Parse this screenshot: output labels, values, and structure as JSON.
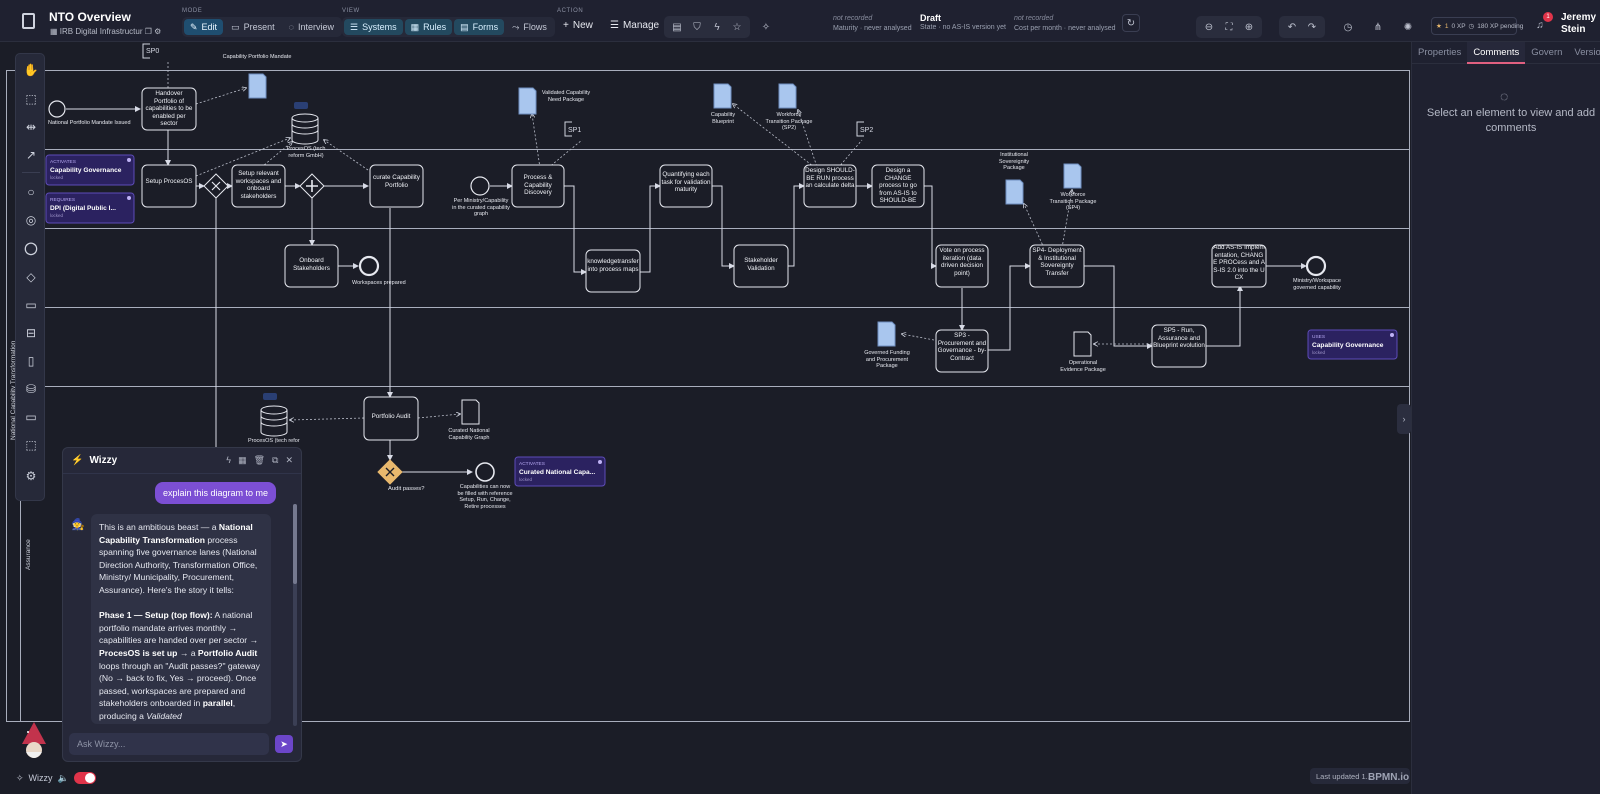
{
  "header": {
    "title": "NTO Overview",
    "subtitle": "IRB Digital Infrastructur",
    "mode_label": "MODE",
    "view_label": "VIEW",
    "action_label": "ACTION",
    "modes": [
      "Edit",
      "Present",
      "Interview"
    ],
    "views": [
      "Systems",
      "Rules",
      "Forms",
      "Flows"
    ],
    "new_label": "New",
    "manage_label": "Manage",
    "status": {
      "maturity_value": "not recorded",
      "maturity_label": "Maturity · never analysed",
      "state_value": "Draft",
      "state_label": "State · no AS-IS version yet",
      "cost_value": "not recorded",
      "cost_label": "Cost per month · never analysed"
    },
    "xp_level": "1",
    "xp_value": "0 XP",
    "xp_pending": "180 XP pending",
    "notification_count": "1",
    "user_name": "Jeremy Stein"
  },
  "sidebar": {
    "tabs": [
      "Properties",
      "Comments",
      "Govern",
      "Versions"
    ],
    "active_tab": "Comments",
    "message": "Select an element to view and add comments"
  },
  "diagram": {
    "pool_name": "National Capability Transformation",
    "lane_last": "Assurance",
    "sp0": "SP0",
    "capability_mandate": "Capability Portfolio Mandate",
    "national_mandate": "National Portfolio Mandate Issued",
    "handover": "Handover Portfolio of capabilities to be enabled per sector",
    "setup_procesos": "Setup ProcesOS",
    "procesos_db": "ProcesOS (tech reform GmbH)",
    "setup_workspaces": "Setup relevant workspaces and onboard stakeholders",
    "curate_portfolio": "curate Capability Portfolio",
    "onboard": "Onboard Stakeholders",
    "workspaces_prepared": "Workspaces prepared",
    "per_ministry": "Per Ministry/Capability in the curated capability graph",
    "validated_pkg": "Validated Capability Need Package",
    "sp1": "SP1",
    "process_discovery": "Process & Capability Discovery",
    "knowledge_transfer": "knowledgetransfer into process maps",
    "quantifying": "Quantifying each task for validation maturity",
    "stakeholder_validation": "Stakeholder Validation",
    "cap_blueprint": "Capability Blueprint",
    "wf_sp2": "Workforce Transition Package (SP2)",
    "sp2": "SP2",
    "design_should": "Design SHOULD-BE RUN process an calculate delta",
    "design_change": "Design a CHANGE process to go from AS-IS to SHOULD-BE",
    "inst_sov_pkg": "Institutional Sovereignity Package",
    "wf_sp4": "Workforce Transition Package (SP4)",
    "vote": "Vote on process iteration (data driven decision point)",
    "sp4": "SP4- Deployment & Institutional Sovereignty Transfer",
    "add_asis": "Add AS-IS Implementation, CHANGE PROCess and AS-IS 2.0 into the UCX",
    "ministry_governed": "Ministry/Workspace governed capability",
    "governed_funding": "Governed Funding and Procurement Package",
    "sp3": "SP3 - Procurement and Governance - by- Contract",
    "operational_evidence": "Operational Evidence Package",
    "sp5": "SP5 - Run, Assurance and Blueprint evolution",
    "portfolio_audit": "Portfolio Audit",
    "curated_graph": "Curated National Capability Graph",
    "audit_passes": "Audit passes?",
    "capabilities_filled": "Capabilities can now be filled with reference Setup, Run, Change, Retire processes",
    "procesos_db2": "ProcesOS (tech reform GmbH)",
    "cards": {
      "activates_label": "ACTIVATES",
      "requires_label": "REQUIRES",
      "uses_label": "USES",
      "locked": "locked",
      "cap_gov": "Capability Governance",
      "dpi": "DPI (Digital Public I...",
      "cap_gov2": "Capability Governance",
      "curated_nat": "Curated National Capa..."
    }
  },
  "wizzy": {
    "title": "Wizzy",
    "user_message": "explain this diagram to me",
    "placeholder": "Ask Wizzy...",
    "footer_label": "Wizzy"
  },
  "footer": {
    "last_updated": "Last updated 1...",
    "brand": "BPMN.io"
  },
  "colors": {
    "accent": "#7c4fd4",
    "edit_active": "#1f4e70",
    "gateway": "#e8b86d",
    "doc_fill": "#a9c6ee",
    "card_purple": "#2b2260",
    "notification": "#e0344a"
  }
}
